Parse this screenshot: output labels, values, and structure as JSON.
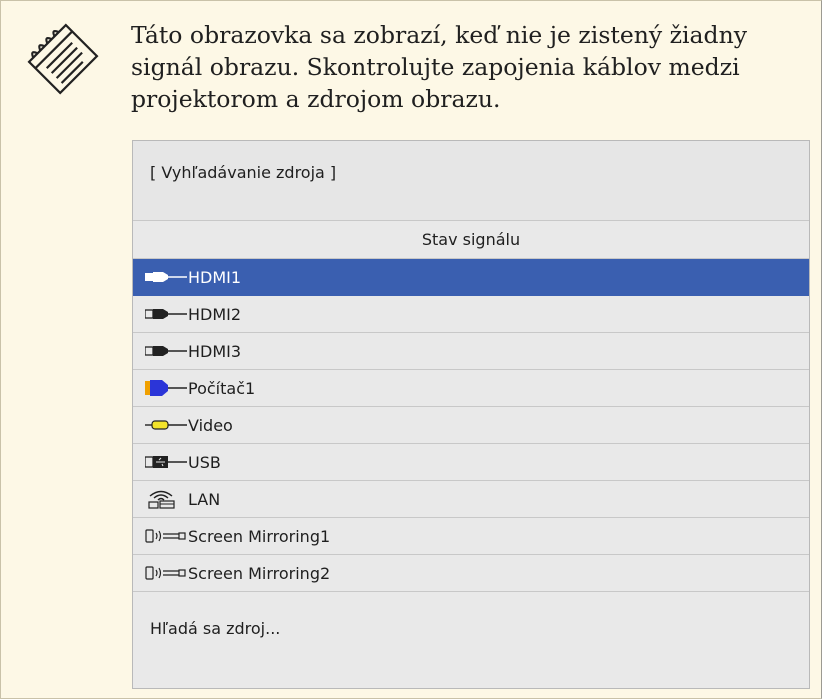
{
  "note": {
    "icon": "note-pencil-icon",
    "text": "Táto obrazovka sa zobrazí, keď nie je zistený žiadny signál obrazu. Skontrolujte zapojenia káblov medzi projektorom a zdrojom obrazu."
  },
  "panel": {
    "title": "[ Vyhľadávanie zdroja ]",
    "column_header": "Stav signálu",
    "sources": [
      {
        "label": "HDMI1",
        "icon": "hdmi-plug-icon",
        "selected": true
      },
      {
        "label": "HDMI2",
        "icon": "hdmi-plug-icon",
        "selected": false
      },
      {
        "label": "HDMI3",
        "icon": "hdmi-plug-icon",
        "selected": false
      },
      {
        "label": "Počítač1",
        "icon": "vga-plug-icon",
        "selected": false
      },
      {
        "label": "Video",
        "icon": "rca-plug-icon",
        "selected": false
      },
      {
        "label": "USB",
        "icon": "usb-plug-icon",
        "selected": false
      },
      {
        "label": "LAN",
        "icon": "wireless-lan-icon",
        "selected": false
      },
      {
        "label": "Screen Mirroring1",
        "icon": "screen-mirroring-icon",
        "selected": false
      },
      {
        "label": "Screen Mirroring2",
        "icon": "screen-mirroring-icon",
        "selected": false
      }
    ],
    "status": "Hľadá sa zdroj..."
  },
  "colors": {
    "note_background": "#fdf8e6",
    "selected_row": "#3a5fb0",
    "panel_background": "#e9e9e9",
    "vga_connector": "#2b35d8",
    "rca_connector": "#f3e32a"
  }
}
